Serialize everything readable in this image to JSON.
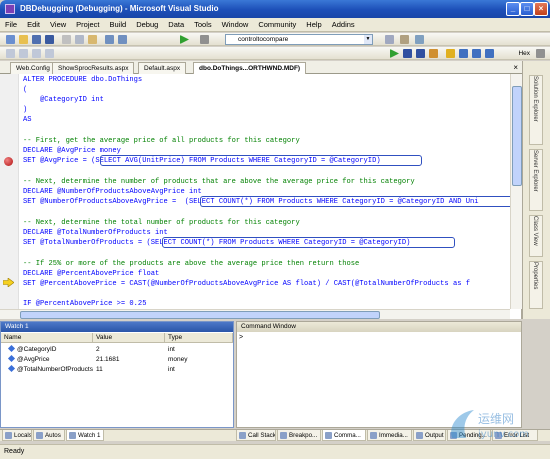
{
  "window": {
    "title": "DBDebugging (Debugging) - Microsoft Visual Studio"
  },
  "menu": [
    "File",
    "Edit",
    "View",
    "Project",
    "Build",
    "Debug",
    "Data",
    "Tools",
    "Window",
    "Community",
    "Help",
    "Addins"
  ],
  "toolbar": {
    "combo_value": "controltocompare",
    "hex_label": "Hex"
  },
  "doc_tabs": [
    "Web.Config",
    "ShowSprocResults.aspx",
    "Default.aspx",
    "dbo.DoThings...ORTHWND.MDF)"
  ],
  "side_tabs": [
    "Solution Explorer",
    "Server Explorer",
    "Class View",
    "Properties"
  ],
  "code": [
    {
      "text": "ALTER PROCEDURE dbo.DoThings",
      "kind": "kw"
    },
    {
      "text": "(",
      "kind": "kw"
    },
    {
      "text": "    @CategoryID int",
      "kind": "kw"
    },
    {
      "text": ")",
      "kind": "kw"
    },
    {
      "text": "AS",
      "kind": "kw"
    },
    {
      "text": "",
      "kind": "kw"
    },
    {
      "text": "-- First, get the average price of all products for this category",
      "kind": "cm"
    },
    {
      "text": "DECLARE @AvgPrice money",
      "kind": "kw"
    },
    {
      "text": "SET @AvgPrice = (SELECT AVG(UnitPrice) FROM Products WHERE CategoryID = @CategoryID)",
      "kind": "kw"
    },
    {
      "text": "",
      "kind": "kw"
    },
    {
      "text": "-- Next, determine the number of products that are above the average price for this category",
      "kind": "cm"
    },
    {
      "text": "DECLARE @NumberOfProductsAboveAvgPrice int",
      "kind": "kw"
    },
    {
      "text": "SET @NumberOfProductsAboveAvgPrice =  (SELECT COUNT(*) FROM Products WHERE CategoryID = @CategoryID AND Uni",
      "kind": "kw"
    },
    {
      "text": "",
      "kind": "kw"
    },
    {
      "text": "-- Next, determine the total number of products for this category",
      "kind": "cm"
    },
    {
      "text": "DECLARE @TotalNumberOfProducts int",
      "kind": "kw"
    },
    {
      "text": "SET @TotalNumberOfProducts = (SELECT COUNT(*) FROM Products WHERE CategoryID = @CategoryID)",
      "kind": "kw"
    },
    {
      "text": "",
      "kind": "kw"
    },
    {
      "text": "-- If 25% or more of the products are above the average price then return those",
      "kind": "cm"
    },
    {
      "text": "DECLARE @PercentAbovePrice float",
      "kind": "kw"
    },
    {
      "text": "SET @PercentAbovePrice = CAST(@NumberOfProductsAboveAvgPrice AS float) / CAST(@TotalNumberOfProducts as f",
      "kind": "kw"
    },
    {
      "text": "",
      "kind": "kw"
    },
    {
      "text": "IF @PercentAbovePrice >= 0.25",
      "kind": "kw"
    }
  ],
  "watch": {
    "title": "Watch 1",
    "columns": [
      "Name",
      "Value",
      "Type"
    ],
    "rows": [
      {
        "name": "@CategoryID",
        "value": "2",
        "type": "int"
      },
      {
        "name": "@AvgPrice",
        "value": "21.1681",
        "type": "money"
      },
      {
        "name": "@TotalNumberOfProducts",
        "value": "11",
        "type": "int"
      }
    ]
  },
  "command": {
    "title": "Command Window",
    "prompt": ">"
  },
  "bottom_tabs_left": [
    "Locals",
    "Autos",
    "Watch 1"
  ],
  "bottom_tabs_right": [
    "Call Stack",
    "Breakpo...",
    "Comma...",
    "Immedia...",
    "Output",
    "Pending...",
    "Error List"
  ],
  "status": "Ready",
  "watermark": {
    "cn": "运维网",
    "url": "iyunv.com"
  }
}
